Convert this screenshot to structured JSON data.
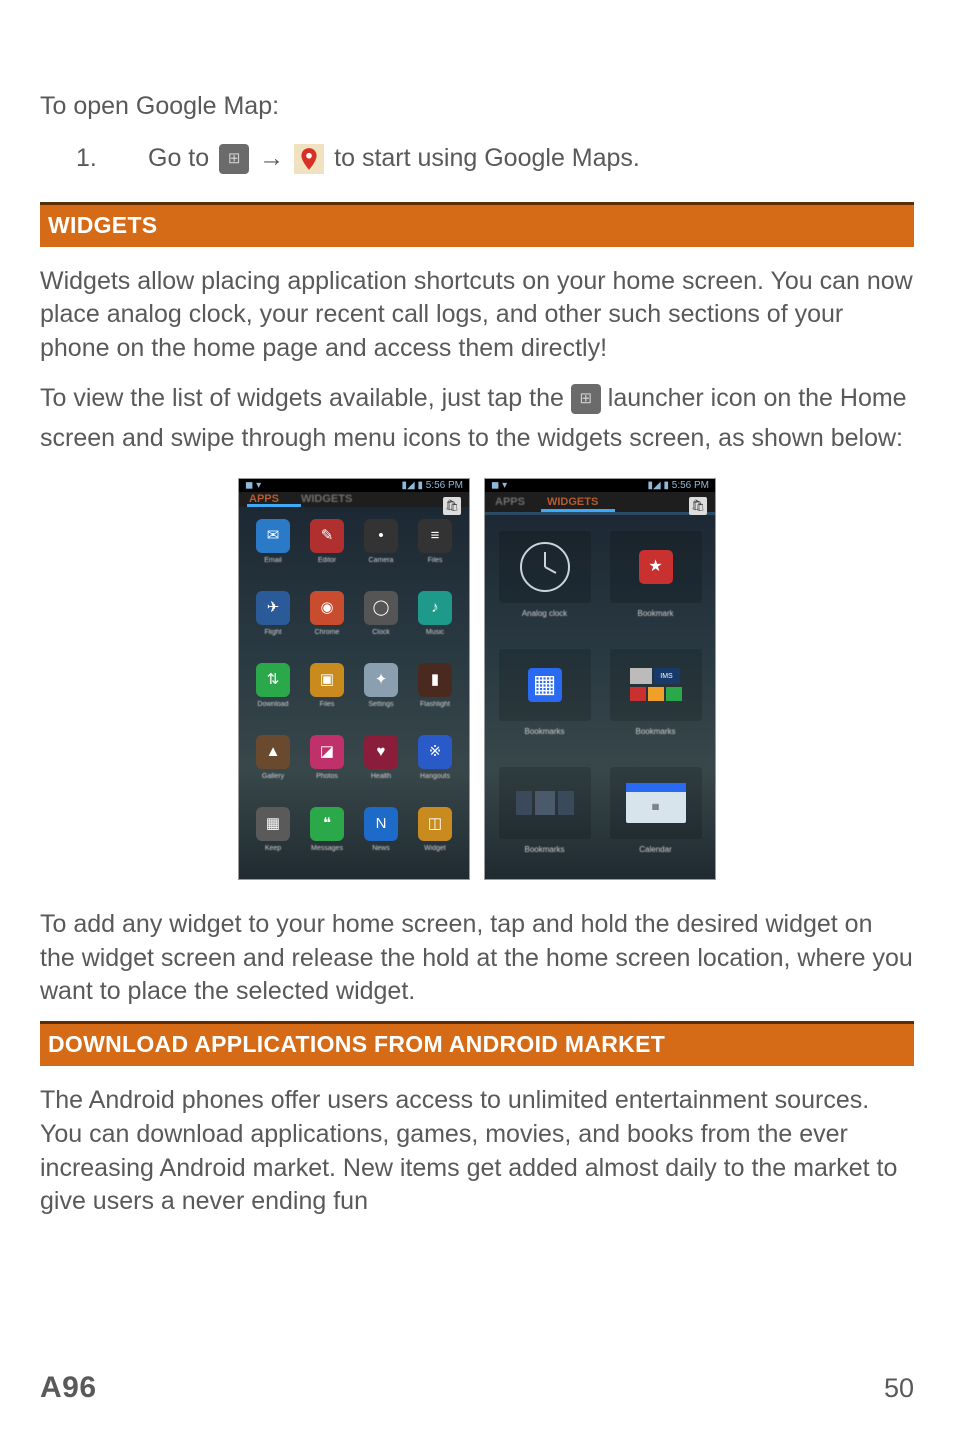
{
  "intro": "To open Google Map:",
  "step": {
    "num": "1.",
    "before": "Go to",
    "after": "to start using Google Maps."
  },
  "arrow": "→",
  "widgets": {
    "heading": "WIDGETS",
    "p1": "Widgets allow placing application shortcuts on your home screen. You can now place analog clock, your recent call logs, and other such sections of your phone on the home page and access them directly!",
    "p2a": "To view the list of widgets available, just tap the ",
    "p2b": " launcher icon on the Home screen and swipe through menu icons to the widgets screen, as shown below:",
    "p3": "To add any widget to your home screen, tap and hold the desired widget on the widget screen and release the hold at the home screen location, where you want to place the selected widget."
  },
  "download": {
    "heading": "DOWNLOAD APPLICATIONS FROM ANDROID MARKET",
    "p1": "The Android phones offer users access to unlimited entertainment sources. You can download applications, games, movies, and books from the ever increasing Android market. New items get added almost daily to the market to give users a never ending fun"
  },
  "shots": {
    "status_left": "◼ ▾",
    "status_right": "▮◢ ▮ 5:56 PM",
    "tab_apps": "APPS",
    "tab_widgets": "WIDGETS",
    "apps": [
      {
        "c": "#2a7ac8",
        "g": "✉",
        "l": "Email"
      },
      {
        "c": "#b03030",
        "g": "✎",
        "l": "Editor"
      },
      {
        "c": "#333",
        "g": "•",
        "l": "Camera"
      },
      {
        "c": "#333",
        "g": "≡",
        "l": "Files"
      },
      {
        "c": "#2a5a98",
        "g": "✈",
        "l": "Flight"
      },
      {
        "c": "#c94c2e",
        "g": "◉",
        "l": "Chrome"
      },
      {
        "c": "#555",
        "g": "◯",
        "l": "Clock"
      },
      {
        "c": "#1e9a8a",
        "g": "♪",
        "l": "Music"
      },
      {
        "c": "#2aa84a",
        "g": "⇅",
        "l": "Download"
      },
      {
        "c": "#c98a1e",
        "g": "▣",
        "l": "Files"
      },
      {
        "c": "#8aa0b0",
        "g": "✦",
        "l": "Settings"
      },
      {
        "c": "#4a2a1e",
        "g": "▮",
        "l": "Flashlight"
      },
      {
        "c": "#6a4a2e",
        "g": "▲",
        "l": "Gallery"
      },
      {
        "c": "#c0306a",
        "g": "◪",
        "l": "Photos"
      },
      {
        "c": "#8a1e3a",
        "g": "♥",
        "l": "Health"
      },
      {
        "c": "#2a5ac8",
        "g": "※",
        "l": "Hangouts"
      },
      {
        "c": "#5a5a5a",
        "g": "▦",
        "l": "Keep"
      },
      {
        "c": "#2aa84a",
        "g": "❝",
        "l": "Messages"
      },
      {
        "c": "#1e6ac8",
        "g": "N",
        "l": "News"
      },
      {
        "c": "#c98a1e",
        "g": "◫",
        "l": "Widget"
      }
    ],
    "widgets_items": [
      {
        "l": "Analog clock",
        "t": "clock"
      },
      {
        "l": "Bookmark",
        "t": "bookmark"
      },
      {
        "l": "Bookmarks",
        "t": "bookmarks-grid"
      },
      {
        "l": "Bookmarks",
        "t": "bookmarks-row"
      },
      {
        "l": "Bookmarks",
        "t": "bookmarks-wide"
      },
      {
        "l": "Calendar",
        "t": "calendar"
      }
    ]
  },
  "footer": {
    "left": "A96",
    "right": "50"
  }
}
